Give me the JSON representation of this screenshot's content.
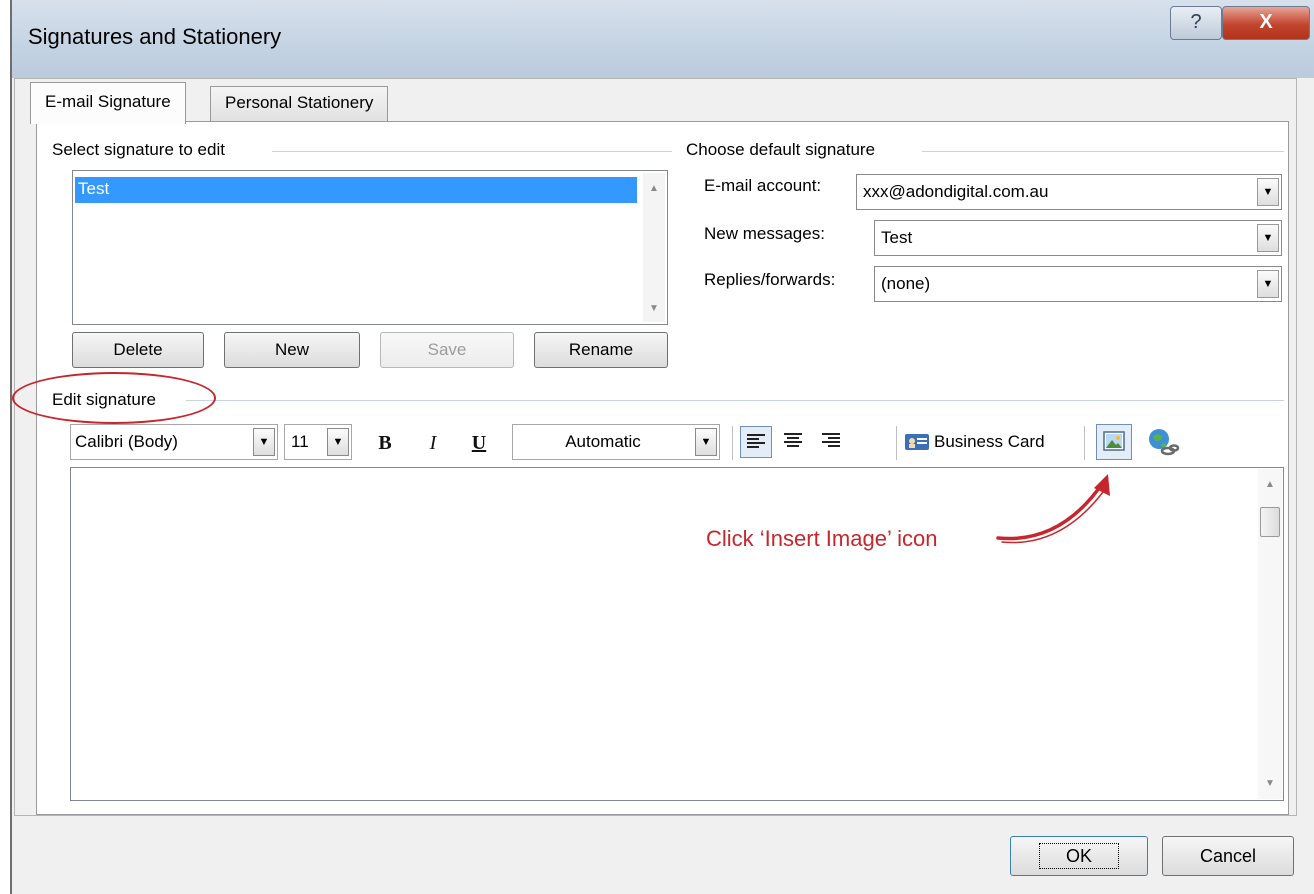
{
  "window": {
    "title": "Signatures and Stationery",
    "help_label": "?",
    "close_label": "X"
  },
  "tabs": [
    {
      "label": "E-mail Signature",
      "active": true
    },
    {
      "label": "Personal Stationery",
      "active": false
    }
  ],
  "select_signature": {
    "label": "Select signature to edit",
    "items": [
      "Test"
    ],
    "selected": "Test",
    "buttons": {
      "delete": "Delete",
      "new": "New",
      "save": "Save",
      "rename": "Rename"
    }
  },
  "default_signature": {
    "label": "Choose default signature",
    "email_account_label": "E-mail account:",
    "email_account_value": "xxx@adondigital.com.au",
    "new_messages_label": "New messages:",
    "new_messages_value": "Test",
    "replies_label": "Replies/forwards:",
    "replies_value": "(none)"
  },
  "edit_signature": {
    "label": "Edit signature",
    "font": "Calibri (Body)",
    "size": "11",
    "bold": "B",
    "italic": "I",
    "underline": "U",
    "color": "Automatic",
    "business_card": "Business Card"
  },
  "annotation": {
    "text": "Click ‘Insert Image’ icon",
    "color": "#c8262d"
  },
  "footer": {
    "ok": "OK",
    "cancel": "Cancel"
  },
  "colors": {
    "selection": "#3399ff",
    "annotation": "#c8262d"
  }
}
